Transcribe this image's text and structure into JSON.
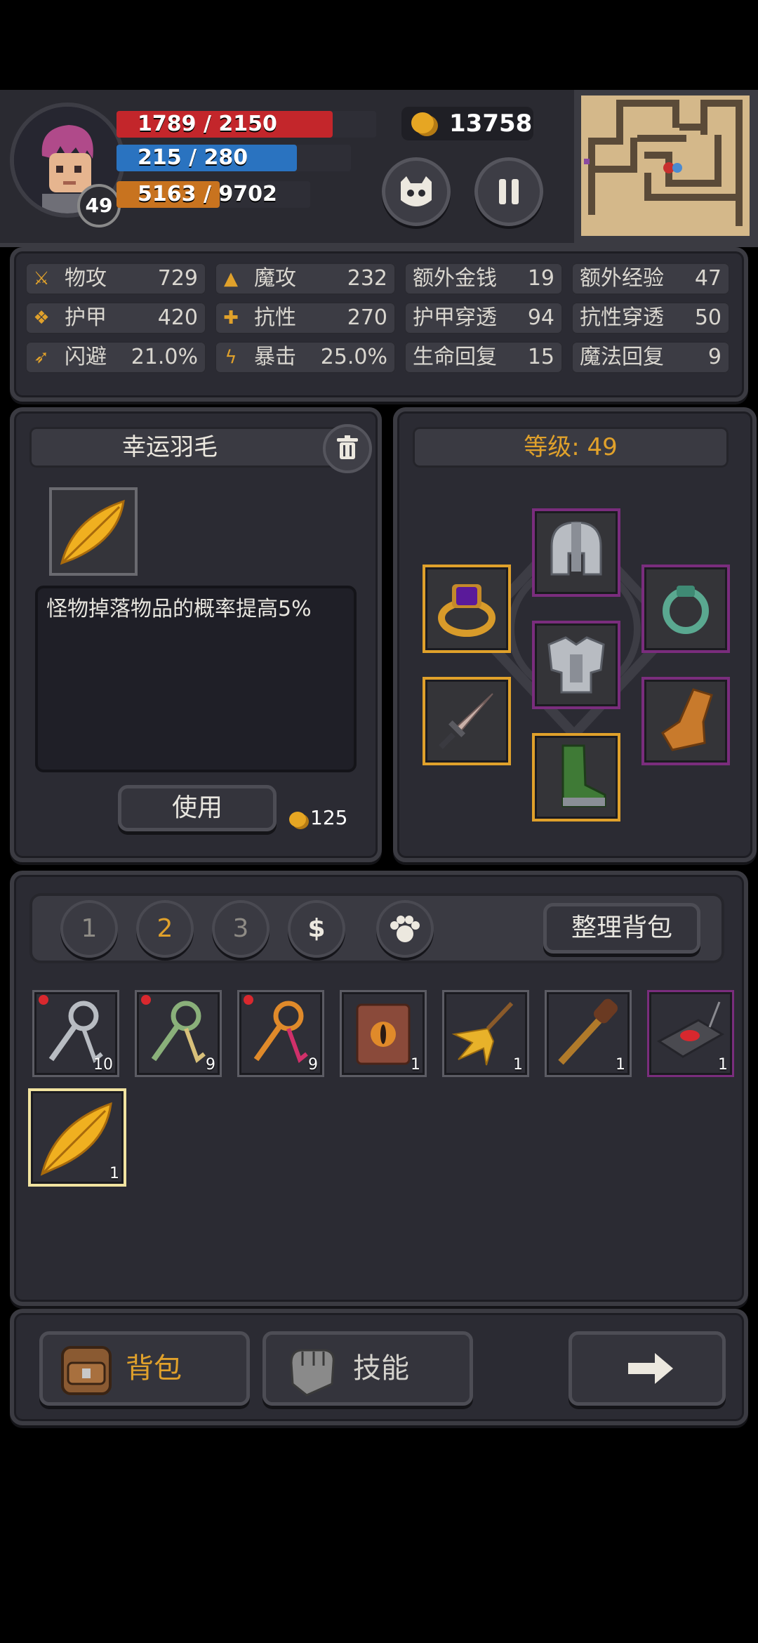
{
  "hud": {
    "level": "49",
    "hp": "1789 / 2150",
    "hp_fraction": 0.832,
    "mp": "215 / 280",
    "mp_fraction": 0.768,
    "xp": "5163 / 9702",
    "xp_fraction": 0.532,
    "gold": "13758"
  },
  "stats": [
    {
      "icon": "sword-icon",
      "label": "物攻",
      "value": "729"
    },
    {
      "icon": "magic-hat-icon",
      "label": "魔攻",
      "value": "232"
    },
    {
      "icon": "",
      "label": "额外金钱",
      "value": "19"
    },
    {
      "icon": "",
      "label": "额外经验",
      "value": "47"
    },
    {
      "icon": "armor-paw-icon",
      "label": "护甲",
      "value": "420"
    },
    {
      "icon": "resist-icon",
      "label": "抗性",
      "value": "270"
    },
    {
      "icon": "",
      "label": "护甲穿透",
      "value": "94"
    },
    {
      "icon": "",
      "label": "抗性穿透",
      "value": "50"
    },
    {
      "icon": "dodge-runner-icon",
      "label": "闪避",
      "value": "21.0%"
    },
    {
      "icon": "crit-bolt-icon",
      "label": "暴击",
      "value": "25.0%"
    },
    {
      "icon": "",
      "label": "生命回复",
      "value": "15"
    },
    {
      "icon": "",
      "label": "魔法回复",
      "value": "9"
    }
  ],
  "item_panel": {
    "title": "幸运羽毛",
    "description": "怪物掉落物品的概率提高5%",
    "use_label": "使用",
    "price": "125"
  },
  "equipment_panel": {
    "level_label": "等级: 49"
  },
  "inventory": {
    "tabs": [
      "1",
      "2",
      "3",
      "$",
      "paw"
    ],
    "active_tab": "2",
    "sort_label": "整理背包",
    "items": [
      {
        "name": "silver-key",
        "count": "10",
        "alert": true
      },
      {
        "name": "green-key",
        "count": "9",
        "alert": true
      },
      {
        "name": "orange-key",
        "count": "9",
        "alert": true
      },
      {
        "name": "eye-tome",
        "count": "1",
        "alert": false
      },
      {
        "name": "golden-leaf-broom",
        "count": "1",
        "alert": false
      },
      {
        "name": "wooden-club",
        "count": "1",
        "alert": false
      },
      {
        "name": "red-button-device",
        "count": "1",
        "alert": false
      },
      {
        "name": "lucky-feather",
        "count": "1",
        "alert": false
      }
    ]
  },
  "bottom_nav": {
    "backpack_label": "背包",
    "skills_label": "技能"
  },
  "colors": {
    "accent": "#e0a12b",
    "hp": "#c3262b",
    "mp": "#2a73c0",
    "xp": "#c8731f",
    "rare_border": "#7a2d7d",
    "legend_border": "#e0a12b"
  }
}
